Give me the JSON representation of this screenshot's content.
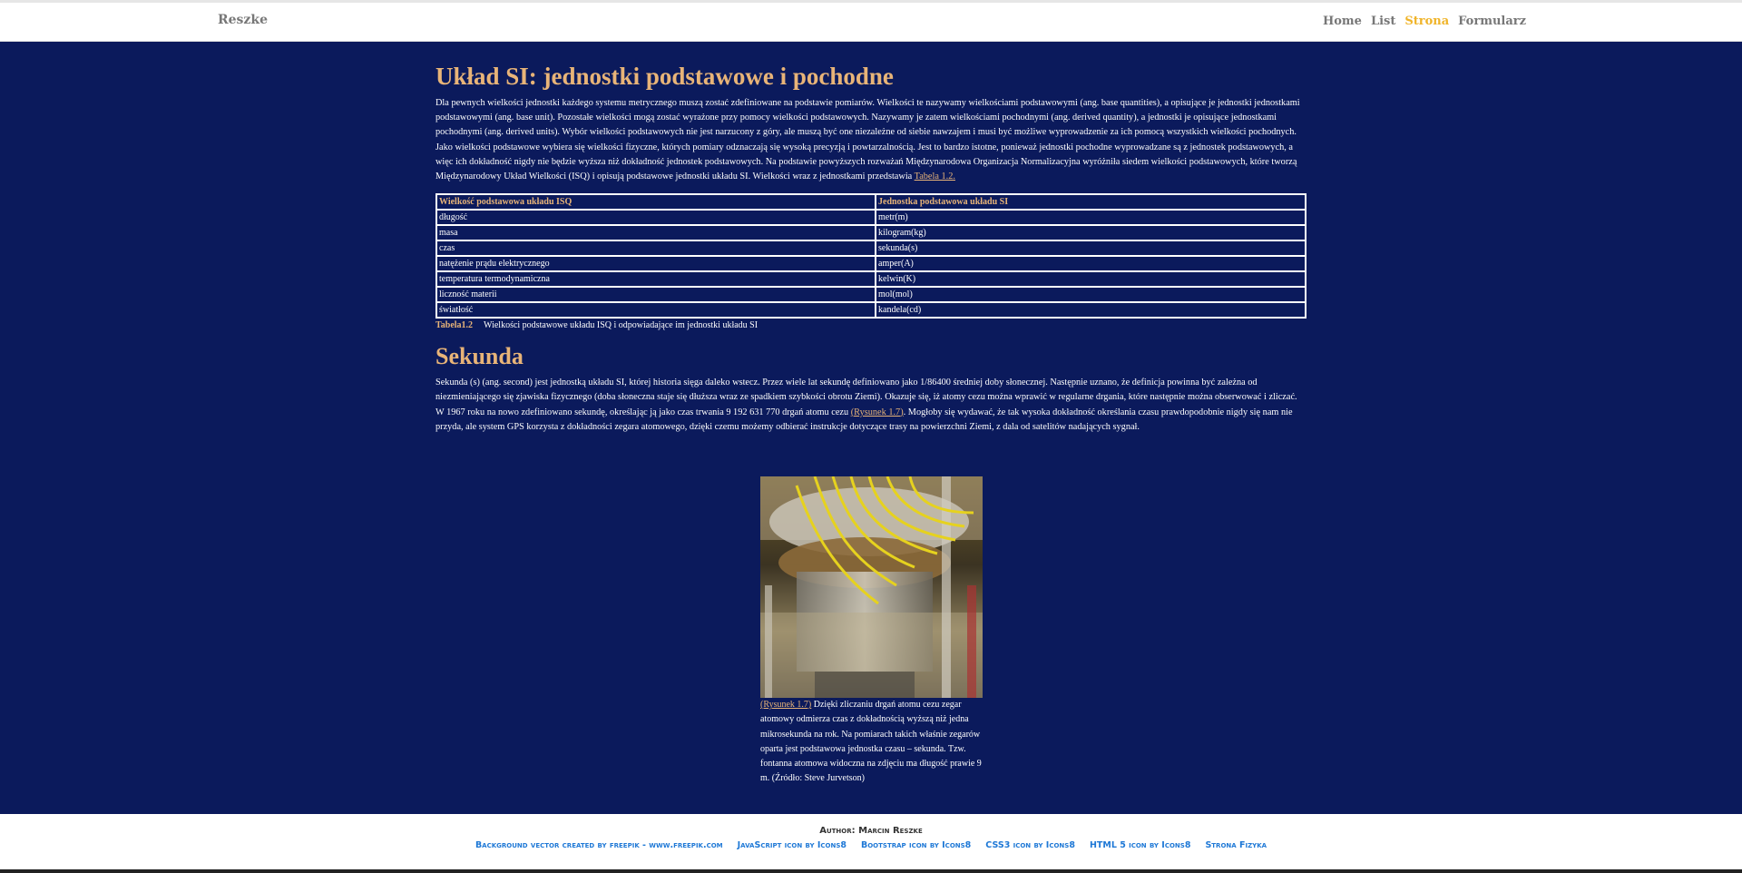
{
  "navbar": {
    "brand": "Reszke",
    "links": [
      "Home",
      "List",
      "Strona",
      "Formularz"
    ],
    "active_link": "Strona",
    "active_color": "#f0b429"
  },
  "main": {
    "background_color": "#0b1a5c",
    "heading_color": "#e8b478",
    "section1": {
      "title": "Układ SI: jednostki podstawowe i pochodne",
      "paragraph": "Dla pewnych wielkości jednostki każdego systemu metrycznego muszą zostać zdefiniowane na podstawie pomiarów. Wielkości te nazywamy wielkościami podstawowymi (ang. base quantities), a opisujące je jednostki jednostkami podstawowymi (ang. base unit). Pozostałe wielkości mogą zostać wyrażone przy pomocy wielkości podstawowych. Nazywamy je zatem wielkościami pochodnymi (ang. derived quantity), a jednostki je opisujące jednostkami pochodnymi (ang. derived units). Wybór wielkości podstawowych nie jest narzucony z góry, ale muszą być one niezależne od siebie nawzajem i musi być możliwe wyprowadzenie za ich pomocą wszystkich wielkości pochodnych. Jako wielkości podstawowe wybiera się wielkości fizyczne, których pomiary odznaczają się wysoką precyzją i powtarzalnością. Jest to bardzo istotne, ponieważ jednostki pochodne wyprowadzane są z jednostek podstawowych, a więc ich dokładność nigdy nie będzie wyższa niż dokładność jednostek podstawowych. Na podstawie powyższych rozważań Międzynarodowa Organizacja Normalizacyjna wyróżniła siedem wielkości podstawowych, które tworzą Międzynarodowy Układ Wielkości (ISQ) i opisują podstawowe jednostki układu SI. Wielkości wraz z jednostkami przedstawia ",
      "table_link": "Tabela 1.2."
    },
    "table": {
      "headers": [
        "Wielkość podstawowa układu ISQ",
        "Jednostka podstawowa układu SI"
      ],
      "rows": [
        [
          "długość",
          "metr(m)"
        ],
        [
          "masa",
          "kilogram(kg)"
        ],
        [
          "czas",
          "sekunda(s)"
        ],
        [
          "natężenie prądu elektrycznego",
          "amper(A)"
        ],
        [
          "temperatura termodynamiczna",
          "kelwin(K)"
        ],
        [
          "liczność materii",
          "mol(mol)"
        ],
        [
          "światłość",
          "kandela(cd)"
        ]
      ],
      "caption_label": "Tabela1.2",
      "caption_text": "Wielkości podstawowe układu ISQ i odpowiadające im jednostki układu SI"
    },
    "section2": {
      "title": "Sekunda",
      "paragraph_before": "Sekunda (s) (ang. second) jest jednostką układu SI, której historia sięga daleko wstecz. Przez wiele lat sekundę definiowano jako 1/86400 średniej doby słonecznej. Następnie uznano, że definicja powinna być zależna od niezmieniającego się zjawiska fizycznego (doba słoneczna staje się dłuższa wraz ze spadkiem szybkości obrotu Ziemi). Okazuje się, iż atomy cezu można wprawić w regularne drgania, które następnie można obserwować i zliczać. W 1967 roku na nowo zdefiniowano sekundę, określając ją jako czas trwania 9 192 631 770 drgań atomu cezu ",
      "figure_link": "(Rysunek 1.7)",
      "paragraph_after": ". Mogłoby się wydawać, że tak wysoka dokładność określania czasu prawdopodobnie nigdy się nam nie przyda, ale system GPS korzysta z dokładności zegara atomowego, dzięki czemu możemy odbierać instrukcje dotyczące trasy na powierzchni Ziemi, z dala od satelitów nadających sygnał."
    },
    "figure": {
      "link": "(Rysunek 1.7)",
      "caption": " Dzięki zliczaniu drgań atomu cezu zegar atomowy odmierza czas z dokładnością wyższą niż jedna mikrosekunda na rok. Na pomiarach takich właśnie zegarów oparta jest podstawowa jednostka czasu – sekunda. Tzw. fontanna atomowa widoczna na zdjęciu ma długość prawie 9 m. (Źródło: Steve Jurvetson)"
    }
  },
  "footer": {
    "author": "Author: Marcin Reszke",
    "credits": [
      "Background vector created by freepik - www.freepik.com",
      "JavaScript icon by Icons8",
      "Bootstrap icon by Icons8",
      "CSS3 icon by Icons8",
      "HTML 5 icon by Icons8",
      "Strona Fizyka"
    ],
    "credit_color": "#1e78d6"
  }
}
